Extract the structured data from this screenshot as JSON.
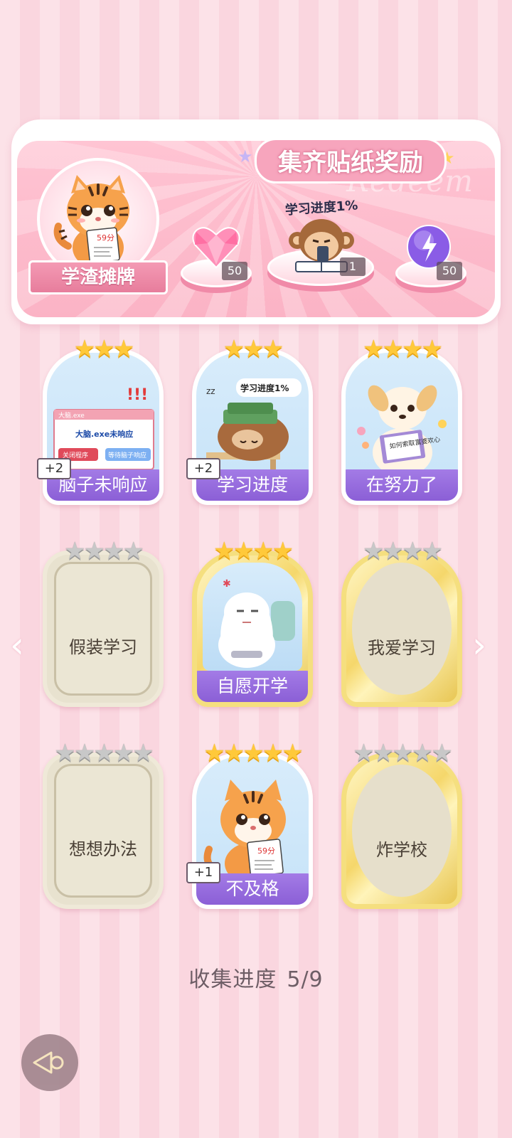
{
  "reward_panel": {
    "title": "集齐贴纸奖励",
    "decor_text": "Redeem",
    "avatar_label": "学渣摊牌",
    "avatar_note": "59分",
    "rewards": [
      {
        "icon": "pink-heart-gem-icon",
        "count": "50"
      },
      {
        "icon": "monkey-study-sticker-icon",
        "count": "1",
        "caption": "学习进度1%"
      },
      {
        "icon": "purple-energy-orb-icon",
        "count": "50"
      }
    ]
  },
  "stickers": [
    {
      "name": "脑子未响应",
      "stars": 3,
      "state": "owned",
      "plus": "+2",
      "art": {
        "window_title": "大脑.exe",
        "message": "大脑.exe未响应",
        "btn1": "关闭程序",
        "btn2": "等待脑子响应"
      }
    },
    {
      "name": "学习进度",
      "stars": 3,
      "state": "owned",
      "plus": "+2",
      "art": {
        "caption": "学习进度1%"
      }
    },
    {
      "name": "在努力了",
      "stars": 4,
      "state": "owned",
      "plus": "",
      "art": {
        "book": "如何索取富婆欢心"
      }
    },
    {
      "name": "假装学习",
      "stars": 4,
      "state": "locked",
      "plus": ""
    },
    {
      "name": "自愿开学",
      "stars": 4,
      "state": "owned-gold",
      "plus": ""
    },
    {
      "name": "我爱学习",
      "stars": 4,
      "state": "locked-gold",
      "plus": ""
    },
    {
      "name": "想想办法",
      "stars": 5,
      "state": "locked",
      "plus": ""
    },
    {
      "name": "不及格",
      "stars": 5,
      "state": "owned",
      "plus": "+1",
      "art": {
        "note": "59分"
      }
    },
    {
      "name": "炸学校",
      "stars": 5,
      "state": "locked-gold",
      "plus": ""
    }
  ],
  "collection": {
    "label": "收集进度",
    "value": "5/9",
    "fraction": 0.5556
  },
  "nav": {
    "prev_icon": "chevron-left-icon",
    "next_icon": "chevron-right-icon"
  },
  "colors": {
    "accent_pink": "#f7a5bd",
    "ribbon_purple": "#8b5fd6",
    "star_gold": "#ffc93a"
  }
}
